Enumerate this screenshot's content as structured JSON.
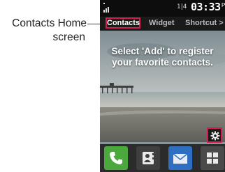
{
  "callout": {
    "line1": "Contacts Home",
    "line2": "screen"
  },
  "status_bar": {
    "indicator": "1|4",
    "time": "03:33",
    "ampm": "PM"
  },
  "tabs": [
    {
      "label": "Contacts",
      "selected": true
    },
    {
      "label": "Widget",
      "selected": false
    },
    {
      "label": "Shortcut >",
      "selected": false
    }
  ],
  "message": {
    "line1": "Select 'Add' to register",
    "line2": "your favorite contacts."
  },
  "settings_button": {
    "icon": "gear-icon"
  },
  "dock": [
    {
      "name": "phone",
      "icon": "phone-icon"
    },
    {
      "name": "contacts",
      "icon": "contact-card-icon"
    },
    {
      "name": "messaging",
      "icon": "envelope-icon"
    },
    {
      "name": "menu",
      "icon": "grid-icon"
    }
  ],
  "colors": {
    "highlight": "#d01e4e",
    "dock_green": "#4aa83c",
    "dock_blue": "#2f6fc2"
  }
}
